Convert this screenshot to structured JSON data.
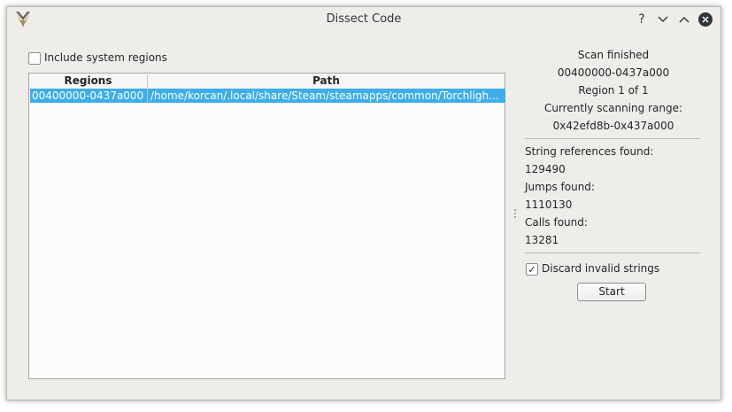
{
  "window": {
    "title": "Dissect Code"
  },
  "titlebar": {
    "help_glyph": "?",
    "minimize_icon": "chevron-down-icon",
    "maximize_icon": "chevron-up-icon",
    "close_icon": "close-icon"
  },
  "options": {
    "include_system_regions": {
      "label": "Include system regions",
      "checked": false
    },
    "discard_invalid_strings": {
      "label": "Discard invalid strings",
      "checked": true,
      "mark": "✓"
    }
  },
  "table": {
    "columns": [
      "Regions",
      "Path"
    ],
    "rows": [
      {
        "region": "00400000-0437a000",
        "path": "/home/korcan/.local/share/Steam/steamapps/common/Torchligh…",
        "selected": true
      }
    ]
  },
  "scan": {
    "status": "Scan finished",
    "range": "00400000-0437a000",
    "region_progress": "Region 1 of 1",
    "current_label": "Currently scanning range:",
    "current_range": "0x42efd8b-0x437a000"
  },
  "results": {
    "strings_label": "String references found:",
    "strings_value": "129490",
    "jumps_label": "Jumps found:",
    "jumps_value": "1110130",
    "calls_label": "Calls found:",
    "calls_value": "13281"
  },
  "actions": {
    "start_label": "Start"
  },
  "colors": {
    "selection": "#3daee9",
    "window_bg": "#efedea",
    "text": "#232629"
  }
}
